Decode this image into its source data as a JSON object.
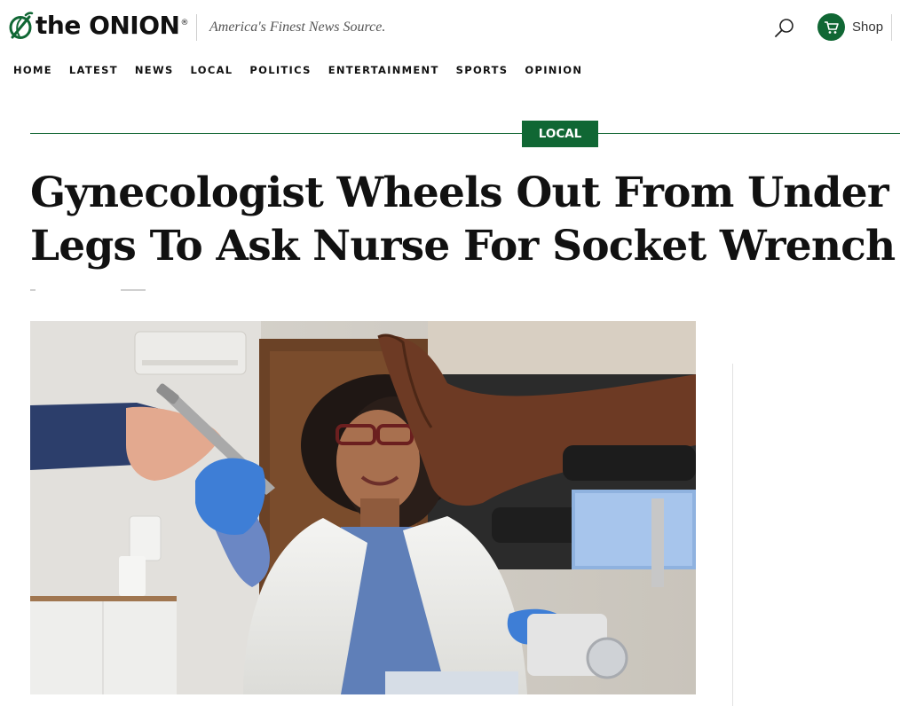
{
  "brand": {
    "logo_word_the": "the",
    "logo_word_name": "ONION",
    "logo_registered": "®",
    "tagline": "America's Finest News Source.",
    "accent_color": "#106734"
  },
  "header": {
    "search_icon": "search-icon",
    "shop_icon": "shopping-cart-icon",
    "shop_label": "Shop"
  },
  "nav": {
    "items": [
      "HOME",
      "LATEST",
      "NEWS",
      "LOCAL",
      "POLITICS",
      "ENTERTAINMENT",
      "SPORTS",
      "OPINION"
    ]
  },
  "article": {
    "section_tag": "LOCAL",
    "headline": "Gynecologist Wheels Out From Under Legs To Ask Nurse For Socket Wrench",
    "hero_image_icon": "article-hero-photo"
  }
}
